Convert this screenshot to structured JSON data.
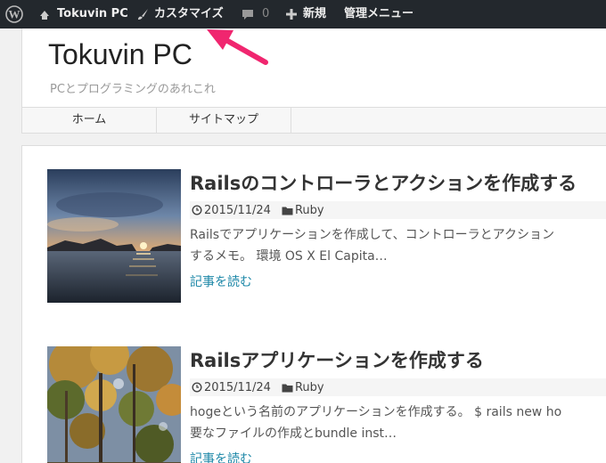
{
  "adminbar": {
    "site_name": "Tokuvin PC",
    "customize": "カスタマイズ",
    "comments_count": "0",
    "new_label": "新規",
    "manage_menu": "管理メニュー"
  },
  "header": {
    "title": "Tokuvin PC",
    "description": "PCとプログラミングのあれこれ"
  },
  "nav": {
    "items": [
      "ホーム",
      "サイトマップ"
    ]
  },
  "posts": [
    {
      "title": "Railsのコントローラとアクションを作成する",
      "date": "2015/11/24",
      "category": "Ruby",
      "excerpt_line1": "Railsでアプリケーションを作成して、コントローラとアクション",
      "excerpt_line2": "するメモ。 環境 OS X El Capita…",
      "read_more": "記事を読む"
    },
    {
      "title": "Railsアプリケーションを作成する",
      "date": "2015/11/24",
      "category": "Ruby",
      "excerpt_line1": "hogeという名前のアプリケーションを作成する。 $ rails new ho",
      "excerpt_line2": "要なファイルの作成とbundle inst…",
      "read_more": "記事を読む"
    }
  ],
  "colors": {
    "adminbar": "#23282d",
    "link": "#1e88a8",
    "arrow": "#f0266f"
  }
}
